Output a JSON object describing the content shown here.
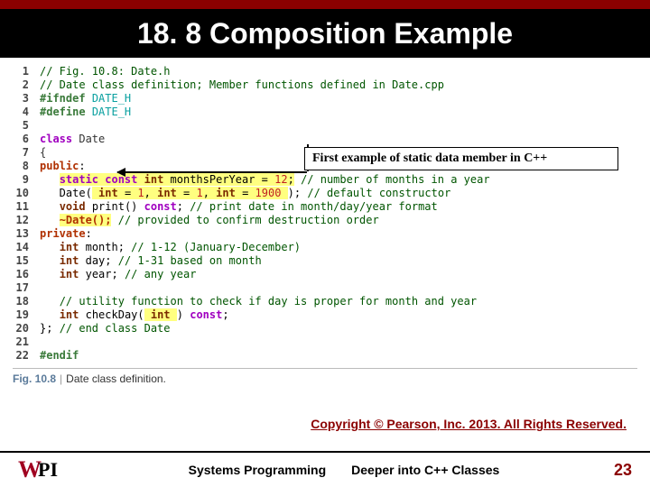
{
  "title": "18. 8 Composition Example",
  "callout": "First example of static data member in C++",
  "code": [
    {
      "n": "1",
      "html": "<span class='tok-comment'>// Fig. 10.8: Date.h</span>"
    },
    {
      "n": "2",
      "html": "<span class='tok-comment'>// Date class definition; Member functions defined in Date.cpp</span>"
    },
    {
      "n": "3",
      "html": "<span class='tok-pre'>#ifndef</span> <span class='tok-preval'>DATE_H</span>"
    },
    {
      "n": "4",
      "html": "<span class='tok-pre'>#define</span> <span class='tok-preval'>DATE_H</span>"
    },
    {
      "n": "5",
      "html": ""
    },
    {
      "n": "6",
      "html": "<span class='tok-kw'>class</span> <span class='tok-id'>Date</span>"
    },
    {
      "n": "7",
      "html": "<span class='tok-id'>{</span>"
    },
    {
      "n": "8",
      "html": "<span class='tok-access'>public</span>:"
    },
    {
      "n": "9",
      "html": "   <span class='hl'><span class='tok-kw'>static const</span> <span class='tok-type'>int</span> monthsPerYear = <span class='tok-num'>12</span>;</span> <span class='tok-comment'>// number of months in a year</span>"
    },
    {
      "n": "10",
      "html": "   Date(<span class='hl'> <span class='tok-type'>int</span> = <span class='tok-num'>1</span>, <span class='tok-type'>int</span> = <span class='tok-num'>1</span>, <span class='tok-type'>int</span> = <span class='tok-num'>1900</span> </span>); <span class='tok-comment'>// default constructor</span>"
    },
    {
      "n": "11",
      "html": "   <span class='tok-type'>void</span> print() <span class='tok-kw'>const</span>; <span class='tok-comment'>// print date in month/day/year format</span>"
    },
    {
      "n": "12",
      "html": "   <span class='hl'><span class='tok-dtor'>~Date();</span></span> <span class='tok-comment'>// provided to confirm destruction order</span>"
    },
    {
      "n": "13",
      "html": "<span class='tok-access'>private</span>:"
    },
    {
      "n": "14",
      "html": "   <span class='tok-type'>int</span> month; <span class='tok-comment'>// 1-12 (January-December)</span>"
    },
    {
      "n": "15",
      "html": "   <span class='tok-type'>int</span> day; <span class='tok-comment'>// 1-31 based on month</span>"
    },
    {
      "n": "16",
      "html": "   <span class='tok-type'>int</span> year; <span class='tok-comment'>// any year</span>"
    },
    {
      "n": "17",
      "html": ""
    },
    {
      "n": "18",
      "html": "   <span class='tok-comment'>// utility function to check if day is proper for month and year</span>"
    },
    {
      "n": "19",
      "html": "   <span class='tok-type'>int</span> checkDay(<span class='hl'> <span class='tok-type'>int</span> </span>) <span class='tok-kw'>const</span>;"
    },
    {
      "n": "20",
      "html": "}; <span class='tok-comment'>// end class Date</span>"
    },
    {
      "n": "21",
      "html": ""
    },
    {
      "n": "22",
      "html": "<span class='tok-pre'>#endif</span>"
    }
  ],
  "figure": {
    "label": "Fig. 10.8",
    "desc": "Date class definition."
  },
  "copyright": "Copyright © Pearson, Inc. 2013. All Rights Reserved.",
  "footer": {
    "left": "Systems Programming",
    "right": "Deeper into C++ Classes",
    "page": "23"
  }
}
